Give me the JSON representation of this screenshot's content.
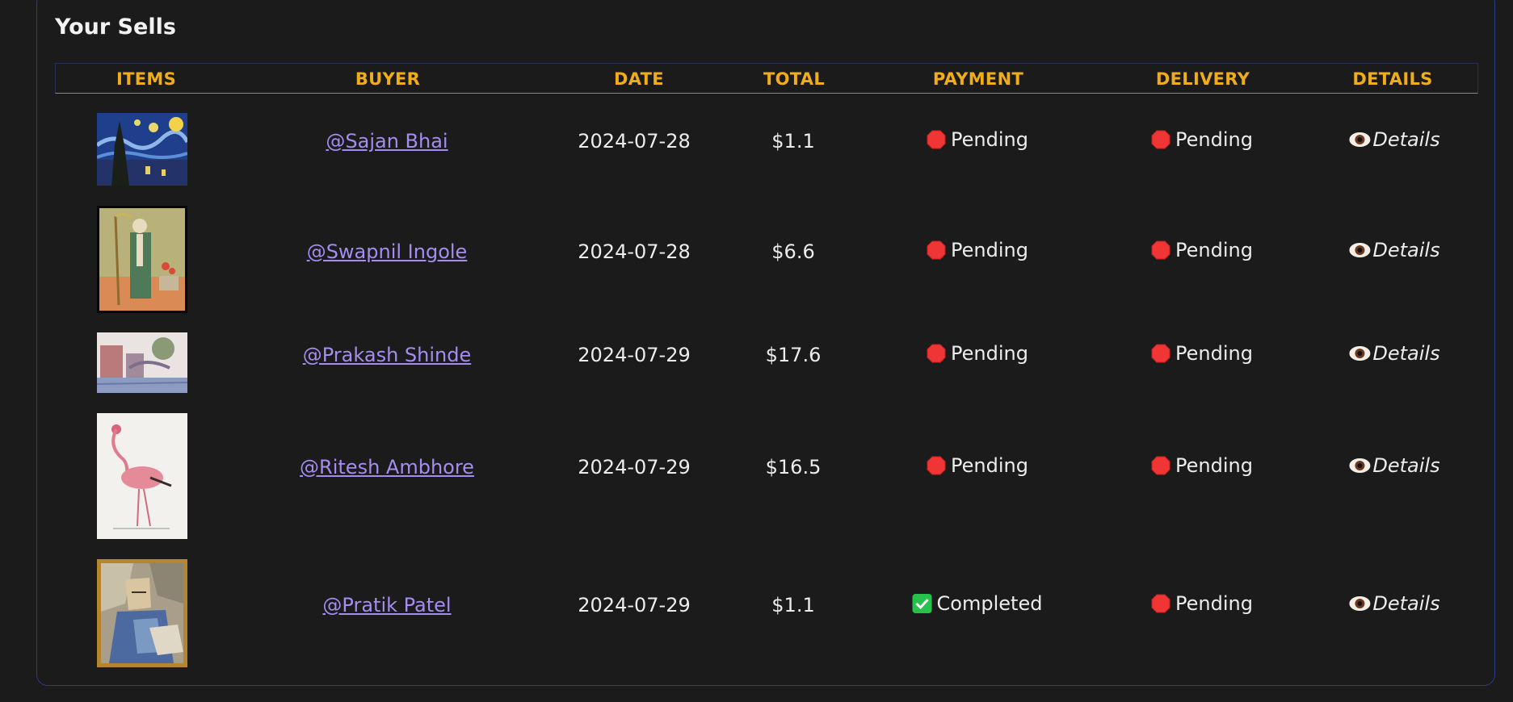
{
  "section": {
    "title": "Your Sells"
  },
  "table": {
    "headers": [
      "ITEMS",
      "BUYER",
      "DATE",
      "TOTAL",
      "PAYMENT",
      "DELIVERY",
      "DETAILS"
    ],
    "rows": [
      {
        "item_art": "starry-night-painting",
        "buyer": "@Sajan Bhai",
        "date": "2024-07-28",
        "total": "$1.1",
        "payment": "Pending",
        "delivery": "Pending",
        "details": "Details"
      },
      {
        "item_art": "skeleton-portrait-painting",
        "buyer": "@Swapnil Ingole",
        "date": "2024-07-28",
        "total": "$6.6",
        "payment": "Pending",
        "delivery": "Pending",
        "details": "Details"
      },
      {
        "item_art": "bridge-watercolor-painting",
        "buyer": "@Prakash Shinde",
        "date": "2024-07-29",
        "total": "$17.6",
        "payment": "Pending",
        "delivery": "Pending",
        "details": "Details"
      },
      {
        "item_art": "flamingo-painting",
        "buyer": "@Ritesh Ambhore",
        "date": "2024-07-29",
        "total": "$16.5",
        "payment": "Pending",
        "delivery": "Pending",
        "details": "Details"
      },
      {
        "item_art": "cubist-portrait-painting",
        "buyer": "@Pratik Patel",
        "date": "2024-07-29",
        "total": "$1.1",
        "payment": "Completed",
        "delivery": "Pending",
        "details": "Details"
      }
    ]
  },
  "colors": {
    "background": "#1b1b1b",
    "header_text": "#f0ad1a",
    "link": "#a48cf0",
    "pending": "#f03535",
    "completed": "#27c24c",
    "panel_border": "#2c3a8f"
  },
  "icons": {
    "pending": "stop-sign-icon",
    "completed": "check-mark-icon",
    "details": "eye-icon"
  }
}
